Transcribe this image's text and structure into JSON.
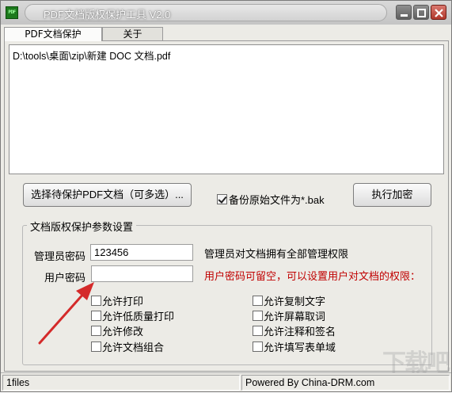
{
  "window": {
    "title": "PDF文档版权保护工具 V2.0",
    "icon_text": "PDF",
    "controls": [
      "minimize-icon",
      "maximize-icon",
      "close-icon"
    ]
  },
  "tabs": [
    {
      "label": "PDF文档保护",
      "active": true
    },
    {
      "label": "关于",
      "active": false
    }
  ],
  "file_list": {
    "items": [
      "D:\\tools\\桌面\\zip\\新建 DOC 文档.pdf"
    ]
  },
  "actions": {
    "select_label": "选择待保护PDF文档（可多选）...",
    "backup_label": "备份原始文件为*.bak",
    "backup_checked": true,
    "encrypt_label": "执行加密"
  },
  "settings": {
    "group_title": "文档版权保护参数设置",
    "admin_label": "管理员密码",
    "admin_value": "123456",
    "admin_note": "管理员对文档拥有全部管理权限",
    "user_label": "用户密码",
    "user_value": "",
    "user_note": "用户密码可留空，可以设置用户对文档的权限：",
    "accent_color": "#c00000",
    "permissions_left": [
      {
        "label": "允许打印",
        "checked": false
      },
      {
        "label": "允许低质量打印",
        "checked": false
      },
      {
        "label": "允许修改",
        "checked": false
      },
      {
        "label": "允许文档组合",
        "checked": false
      }
    ],
    "permissions_right": [
      {
        "label": "允许复制文字",
        "checked": false
      },
      {
        "label": "允许屏幕取词",
        "checked": false
      },
      {
        "label": "允许注释和签名",
        "checked": false
      },
      {
        "label": "允许填写表单域",
        "checked": false
      }
    ]
  },
  "status": {
    "files": "1files",
    "powered": "Powered By China-DRM.com"
  },
  "watermark": "下载吧"
}
